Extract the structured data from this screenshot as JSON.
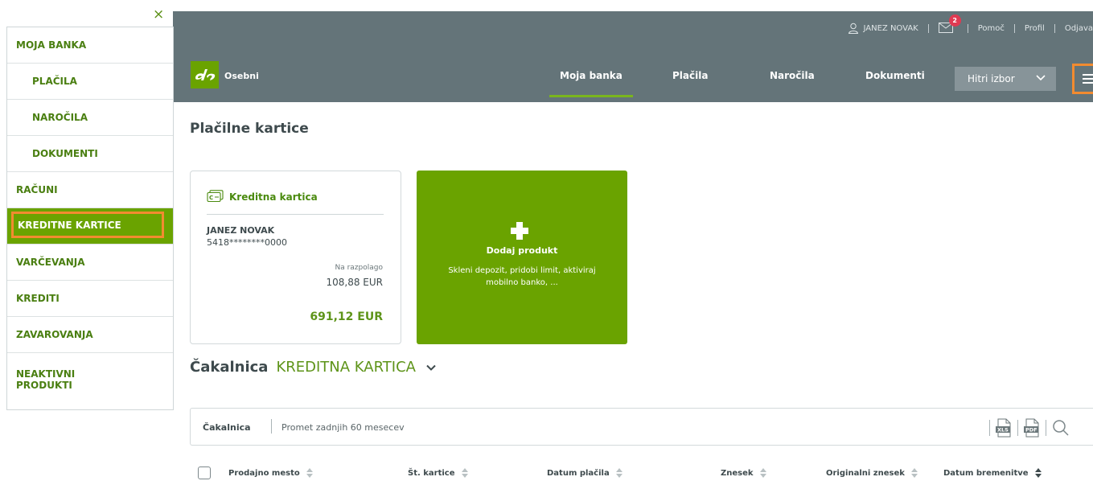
{
  "header": {
    "user_name": "JANEZ NOVAK",
    "message_count": "2",
    "help_label": "Pomoč",
    "profile_label": "Profil",
    "logout_label": "Odjava",
    "brand": "Osebni",
    "tabs": [
      {
        "label": "Moja banka",
        "active": true
      },
      {
        "label": "Plačila",
        "active": false
      },
      {
        "label": "Naročila",
        "active": false
      },
      {
        "label": "Dokumenti",
        "active": false
      }
    ],
    "quick_select": "Hitri izbor"
  },
  "sidemenu": {
    "close_label": "×",
    "items": [
      {
        "label": "MOJA BANKA"
      },
      {
        "label": "PLAČILA"
      },
      {
        "label": "NAROČILA"
      },
      {
        "label": "DOKUMENTI"
      },
      {
        "label": "RAČUNI"
      },
      {
        "label": "KREDITNE KARTICE",
        "active": true
      },
      {
        "label": "VARČEVANJA"
      },
      {
        "label": "KREDITI"
      },
      {
        "label": "ZAVAROVANJA"
      },
      {
        "label": "NEAKTIVNI PRODUKTI"
      }
    ]
  },
  "main": {
    "page_title": "Plačilne kartice",
    "card": {
      "type_label": "Kreditna kartica",
      "holder": "JANEZ NOVAK",
      "number": "5418********0000",
      "available_label": "Na razpolago",
      "available": "108,88 EUR",
      "amount": "691,12 EUR"
    },
    "add_product": {
      "title": "Dodaj produkt",
      "text": "Skleni depozit, pridobi limit, aktiviraj mobilno banko, ..."
    },
    "queue": {
      "title": "Čakalnica",
      "filter": "KREDITNA KARTICA"
    },
    "table": {
      "tab_label": "Čakalnica",
      "subtitle": "Promet zadnjih 60 mesecev",
      "columns": [
        "Prodajno mesto",
        "Št. kartice",
        "Datum plačila",
        "Znesek",
        "Originalni znesek",
        "Datum bremenitve"
      ]
    }
  },
  "colors": {
    "header_bg": "#647479",
    "brand_green": "#6aa300",
    "text_green": "#4a7f11",
    "highlight_orange": "#f28b30",
    "badge_red": "#e03a52"
  }
}
